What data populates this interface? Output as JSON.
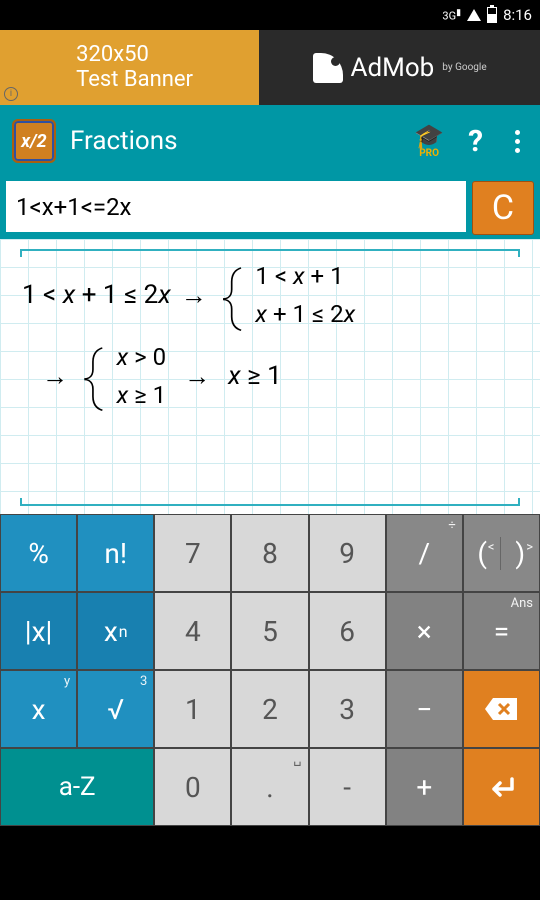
{
  "status": {
    "net": "3G",
    "time": "8:16"
  },
  "ad": {
    "left_line1": "320x50",
    "left_line2": "Test Banner",
    "brand": "AdMob",
    "by": "by Google"
  },
  "bar": {
    "title": "Fractions",
    "icon": "x/2",
    "pro": "PRO",
    "help": "?"
  },
  "input": {
    "value": "1<x+1<=2x",
    "clear": "C"
  },
  "work": {
    "expr": "1 < x + 1 ≤ 2x",
    "sys1a": "1 < x + 1",
    "sys1b": "x + 1 ≤ 2x",
    "sys2a": "x > 0",
    "sys2b": "x ≥ 1",
    "final": "x ≥ 1",
    "arrow": "→"
  },
  "keys": {
    "pct": "%",
    "fact": "n!",
    "k7": "7",
    "k8": "8",
    "k9": "9",
    "div": "/",
    "div_s": "÷",
    "lp": "(",
    "lp_s": "<",
    "rp": ")",
    "rp_s": ">",
    "abs": "|x|",
    "pow": "x",
    "pow_n": "n",
    "k4": "4",
    "k5": "5",
    "k6": "6",
    "mul": "×",
    "eq": "=",
    "eq_s": "Ans",
    "x": "x",
    "x_s": "y",
    "sqrt": "√",
    "sqrt_s": "3",
    "k1": "1",
    "k2": "2",
    "k3": "3",
    "minus": "−",
    "az": "a-Z",
    "k0": "0",
    "dot": ".",
    "dot_s": "␣",
    "neg": "-",
    "plus": "+"
  }
}
